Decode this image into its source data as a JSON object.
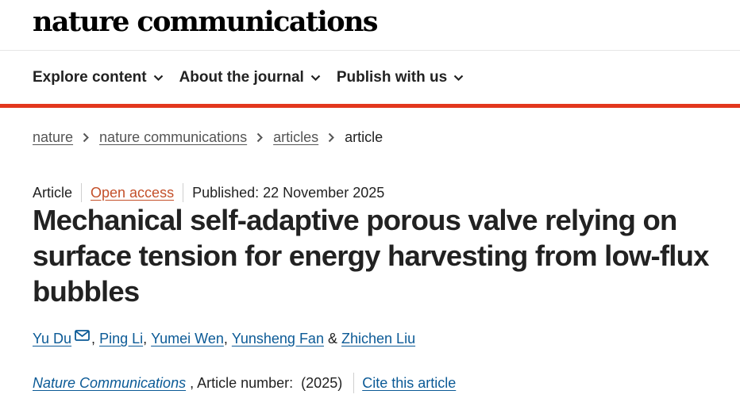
{
  "header": {
    "logo": "nature communications"
  },
  "nav": {
    "items": [
      {
        "label": "Explore content",
        "icon": "chevron-down-icon"
      },
      {
        "label": "About the journal",
        "icon": "chevron-down-icon"
      },
      {
        "label": "Publish with us",
        "icon": "chevron-down-icon"
      }
    ]
  },
  "accent_color": "#e3371e",
  "breadcrumb": {
    "links": [
      "nature",
      "nature communications",
      "articles"
    ],
    "current": "article"
  },
  "article_meta": {
    "type": "Article",
    "access": "Open access",
    "published": "Published: 22 November 2025"
  },
  "article": {
    "title": "Mechanical self-adaptive porous valve relying on surface tension for energy harvesting from low-flux bubbles"
  },
  "authors": {
    "list": [
      "Yu Du",
      "Ping Li",
      "Yumei Wen",
      "Yunsheng Fan",
      "Zhichen Liu"
    ],
    "conjunction": "&",
    "email_icon": "envelope-icon"
  },
  "citation": {
    "journal": "Nature Communications",
    "details": ", Article number:",
    "year": "(2025)",
    "cite_link": "Cite this article"
  }
}
